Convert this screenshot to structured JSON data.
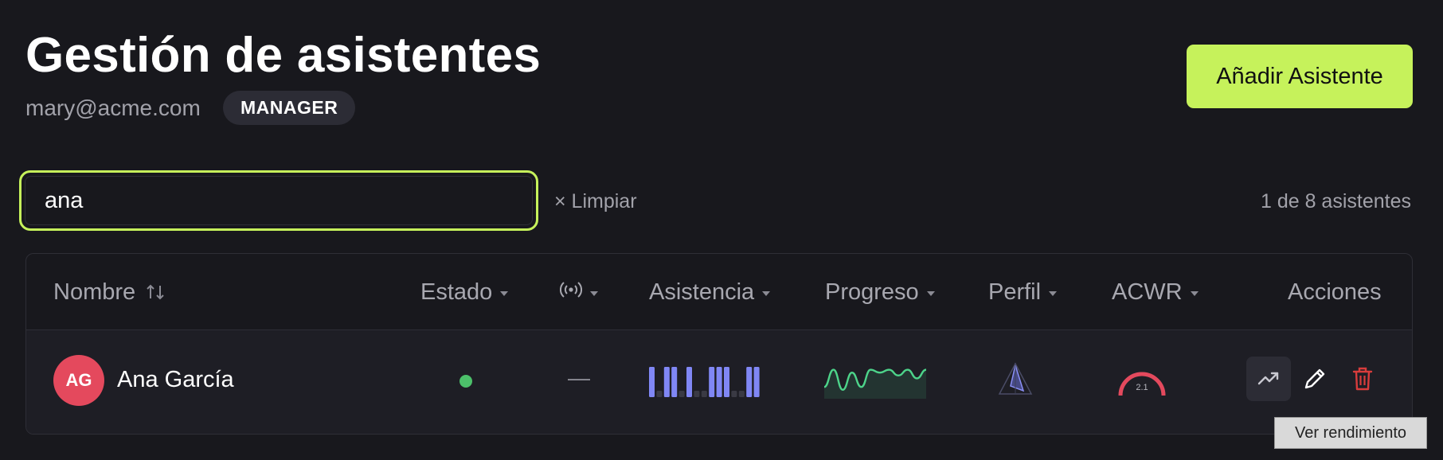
{
  "header": {
    "title": "Gestión de asistentes",
    "email": "mary@acme.com",
    "role": "MANAGER",
    "add_button": "Añadir Asistente"
  },
  "search": {
    "value": "ana",
    "placeholder": "",
    "clear_label": "× Limpiar",
    "result_count": "1 de 8 asistentes"
  },
  "table": {
    "columns": {
      "name": "Nombre",
      "status": "Estado",
      "signal": "signal-icon",
      "attendance": "Asistencia",
      "progress": "Progreso",
      "profile": "Perfil",
      "acwr": "ACWR",
      "actions": "Acciones"
    },
    "rows": [
      {
        "initials": "AG",
        "name": "Ana García",
        "status_color": "#4cc06a",
        "signal": "—",
        "attendance": [
          1,
          0,
          1,
          1,
          0,
          1,
          0,
          0,
          1,
          1,
          1,
          0,
          0,
          1,
          1
        ],
        "progress": [
          3,
          9,
          2,
          8,
          3,
          9,
          8,
          9,
          7,
          9,
          6,
          9
        ],
        "acwr": "2.1",
        "acwr_value": 2.1
      }
    ]
  },
  "tooltip": "Ver rendimiento",
  "colors": {
    "accent": "#c6f25b",
    "background": "#18181d",
    "avatar": "#e4495d",
    "status_active": "#4cc06a",
    "attendance_bar": "#8087f5",
    "progress_line": "#4dd48a",
    "profile": "#7a7fe8",
    "acwr": "#e4495d",
    "delete": "#d83c3c"
  }
}
